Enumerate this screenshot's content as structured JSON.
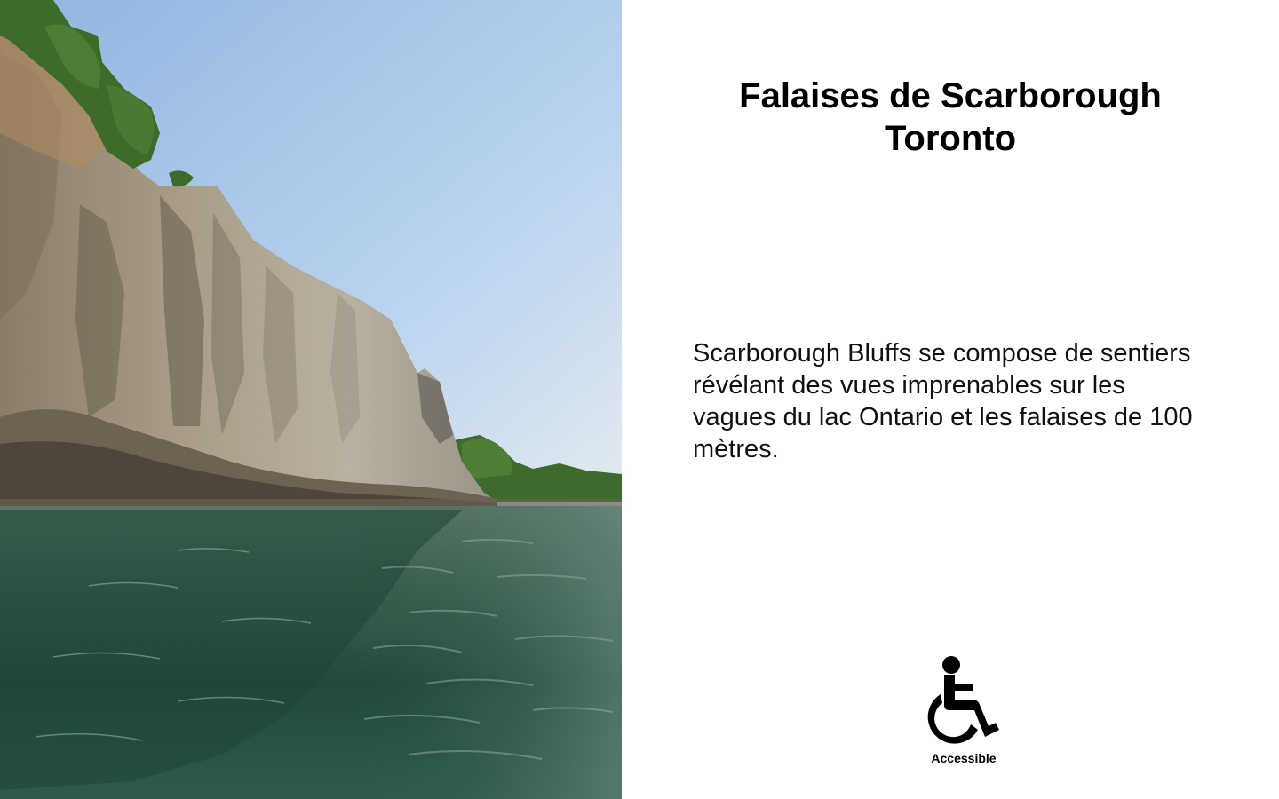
{
  "photo": {
    "subject": "scarborough-bluffs-cliffs-over-lake",
    "colors": {
      "sky_top": "#9fc3ea",
      "sky_bottom": "#dfe8ee",
      "cliff_light": "#b9ad97",
      "cliff_dark": "#6e6455",
      "trees": "#3f6b2e",
      "water_top": "#5f7a6a",
      "water_bottom": "#173f33"
    }
  },
  "title": {
    "line1": "Falaises de Scarborough",
    "line2": "Toronto"
  },
  "description": "Scarborough Bluffs se compose de sentiers révélant des vues imprenables sur les vagues du lac Ontario et les falaises de 100 mètres.",
  "accessibility": {
    "icon": "wheelchair-icon",
    "label": "Accessible"
  }
}
